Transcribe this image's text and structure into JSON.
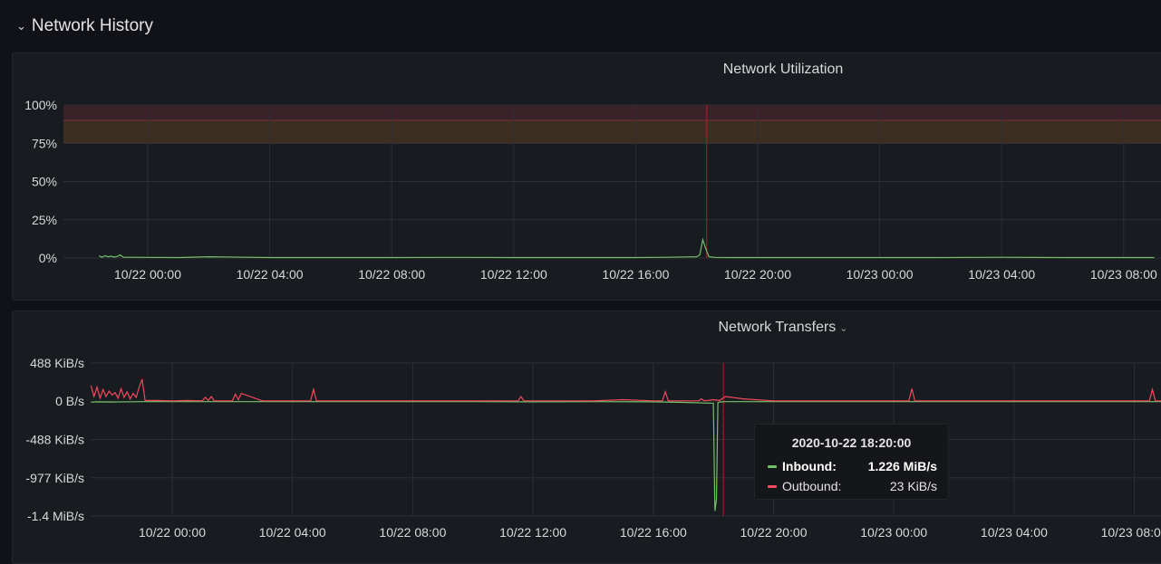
{
  "row": {
    "title": "Network History"
  },
  "panels": {
    "utilization": {
      "title": "Network Utilization"
    },
    "transfers": {
      "title": "Network Transfers"
    }
  },
  "tooltip": {
    "time": "2020-10-22 18:20:00",
    "rows": [
      {
        "name": "Inbound:",
        "value": "1.226 MiB/s",
        "color": "#73bf69"
      },
      {
        "name": "Outbound:",
        "value": "23 KiB/s",
        "color": "#f2495c"
      }
    ]
  },
  "chart_data": [
    {
      "type": "line",
      "title": "Network Utilization",
      "x_tick_labels": [
        "10/22 00:00",
        "10/22 04:00",
        "10/22 08:00",
        "10/22 12:00",
        "10/22 16:00",
        "10/22 20:00",
        "10/23 00:00",
        "10/23 04:00",
        "10/23 08:00"
      ],
      "y_tick_labels": [
        "0%",
        "25%",
        "50%",
        "75%",
        "100%"
      ],
      "ylim": [
        0,
        100
      ],
      "thresholds": [
        {
          "from": 75,
          "to": 90,
          "color": "#ff9830"
        },
        {
          "from": 90,
          "to": 100,
          "color": "#f2495c"
        }
      ],
      "grid": true,
      "annotation_time_hours": 18.33,
      "series": [
        {
          "color": "#73bf69",
          "x_hours": [
            -1.6,
            -1.5,
            -1.4,
            -1.3,
            -1.2,
            -1.1,
            -1.0,
            -0.9,
            -0.8,
            -0.6,
            0,
            1,
            2,
            4,
            6,
            8,
            10,
            12,
            14,
            16,
            17,
            18,
            18.1,
            18.2,
            18.3,
            18.4,
            18.6,
            19,
            20,
            22,
            24,
            26,
            28,
            30,
            32,
            33
          ],
          "values": [
            1.5,
            0.5,
            1.5,
            0.8,
            1.2,
            0.6,
            1.0,
            2.0,
            0.5,
            0.5,
            0.4,
            0.3,
            0.8,
            0.3,
            0.3,
            0.3,
            0.4,
            0.3,
            0.3,
            0.3,
            0.5,
            0.8,
            2.0,
            12.0,
            6.0,
            0.8,
            0.4,
            0.3,
            0.3,
            0.3,
            0.3,
            0.3,
            0.5,
            0.3,
            0.3,
            0.3
          ]
        }
      ]
    },
    {
      "type": "line",
      "title": "Network Transfers",
      "x_tick_labels": [
        "10/22 00:00",
        "10/22 04:00",
        "10/22 08:00",
        "10/22 12:00",
        "10/22 16:00",
        "10/22 20:00",
        "10/23 00:00",
        "10/23 04:00",
        "10/23 08:00"
      ],
      "y_tick_labels": [
        "-1.4 MiB/s",
        "-977 KiB/s",
        "-488 KiB/s",
        "0 B/s",
        "488 KiB/s"
      ],
      "y_tick_values": [
        -1465,
        -977,
        -488,
        0,
        488
      ],
      "ylim": [
        -1465,
        488
      ],
      "grid": true,
      "annotation_time_hours": 18.33,
      "series": [
        {
          "name": "Inbound",
          "color": "#73bf69",
          "x_hours": [
            -2.7,
            -2.5,
            -2.0,
            -1.0,
            0,
            2,
            4,
            6,
            8,
            10,
            12,
            14,
            16,
            17,
            18.0,
            18.05,
            18.1,
            18.15,
            18.2,
            18.3,
            18.4,
            18.6,
            19,
            20,
            22,
            24,
            26,
            28,
            30,
            32,
            33
          ],
          "values": [
            -12,
            -8,
            -10,
            -6,
            -5,
            -5,
            -5,
            -5,
            -5,
            -5,
            -8,
            -5,
            -8,
            -15,
            -25,
            -1400,
            -1255,
            -20,
            -10,
            -8,
            -6,
            -5,
            -5,
            -5,
            -5,
            -5,
            -5,
            -5,
            -5,
            -5,
            -5
          ]
        },
        {
          "name": "Outbound",
          "color": "#f2495c",
          "x_hours": [
            -2.7,
            -2.6,
            -2.5,
            -2.4,
            -2.3,
            -2.2,
            -2.1,
            -2.0,
            -1.9,
            -1.8,
            -1.7,
            -1.6,
            -1.5,
            -1.4,
            -1.3,
            -1.2,
            -1.1,
            -1.0,
            -0.9,
            -0.5,
            0,
            0.5,
            1,
            1.1,
            1.2,
            1.3,
            1.4,
            1.5,
            2,
            2.1,
            2.2,
            2.3,
            3,
            4,
            4.6,
            4.7,
            4.8,
            6,
            8,
            10,
            11.5,
            11.6,
            11.7,
            12,
            14,
            15,
            16,
            16.3,
            16.4,
            16.5,
            17,
            17.5,
            17.6,
            17.7,
            18,
            18.2,
            18.4,
            19,
            20,
            22,
            24,
            24.5,
            24.6,
            24.7,
            26,
            28,
            30,
            32,
            32.5,
            32.6,
            32.7,
            33
          ],
          "values": [
            200,
            60,
            180,
            40,
            150,
            60,
            130,
            80,
            110,
            40,
            160,
            50,
            120,
            30,
            100,
            50,
            180,
            280,
            10,
            10,
            5,
            10,
            5,
            50,
            10,
            60,
            5,
            5,
            5,
            90,
            20,
            100,
            5,
            5,
            5,
            150,
            5,
            5,
            5,
            5,
            5,
            60,
            5,
            5,
            5,
            20,
            5,
            5,
            120,
            5,
            5,
            5,
            30,
            5,
            20,
            10,
            60,
            30,
            5,
            5,
            5,
            5,
            160,
            5,
            5,
            5,
            5,
            5,
            5,
            150,
            5,
            5
          ]
        }
      ]
    }
  ]
}
